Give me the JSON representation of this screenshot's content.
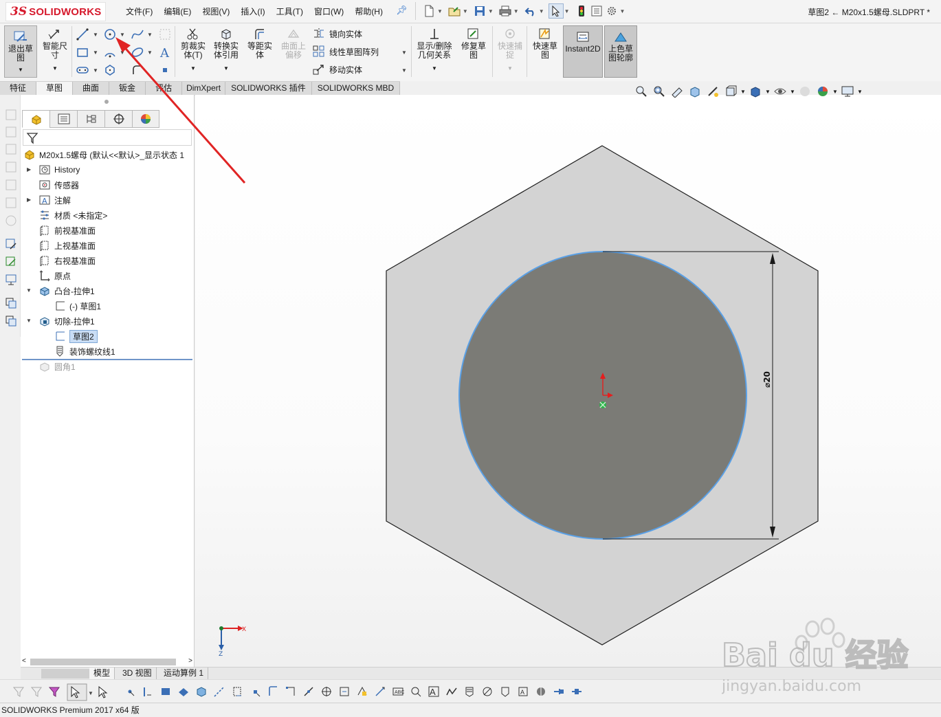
{
  "app": {
    "brand_ds": "3S",
    "brand_name": "SOLIDWORKS",
    "document_title": "草图2 ← M20x1.5螺母.SLDPRT *",
    "status_text": "SOLIDWORKS Premium 2017 x64 版"
  },
  "menu": [
    "文件(F)",
    "编辑(E)",
    "视图(V)",
    "插入(I)",
    "工具(T)",
    "窗口(W)",
    "帮助(H)"
  ],
  "ribbon": {
    "exit_sketch": [
      "退出草",
      "图"
    ],
    "smart_dim": [
      "智能尺",
      "寸"
    ],
    "trim": [
      "剪裁实",
      "体(T)"
    ],
    "convert": [
      "转换实",
      "体引用"
    ],
    "offset": [
      "等距实",
      "体"
    ],
    "surface_offset": [
      "曲面上",
      "偏移"
    ],
    "mirror": "镜向实体",
    "linear_pattern": "线性草图阵列",
    "move": "移动实体",
    "show_relations": [
      "显示/删除",
      "几何关系"
    ],
    "repair": [
      "修复草",
      "图"
    ],
    "rapid_snap": [
      "快速捕",
      "捉"
    ],
    "rapid_sketch": [
      "快速草",
      "图"
    ],
    "instant2d": "Instant2D",
    "shaded_sketch": [
      "上色草",
      "图轮廓"
    ]
  },
  "tabs": [
    "特征",
    "草图",
    "曲面",
    "钣金",
    "评估",
    "DimXpert",
    "SOLIDWORKS 插件",
    "SOLIDWORKS MBD"
  ],
  "active_tab": "草图",
  "tree": {
    "root": "M20x1.5螺母  (默认<<默认>_显示状态 1",
    "items": [
      {
        "label": "History"
      },
      {
        "label": "传感器"
      },
      {
        "label": "注解"
      },
      {
        "label": "材质 <未指定>"
      },
      {
        "label": "前视基准面"
      },
      {
        "label": "上视基准面"
      },
      {
        "label": "右视基准面"
      },
      {
        "label": "原点"
      },
      {
        "label": "凸台-拉伸1"
      },
      {
        "label": "(-) 草图1"
      },
      {
        "label": "切除-拉伸1"
      },
      {
        "label": "草图2"
      },
      {
        "label": "装饰螺纹线1"
      },
      {
        "label": "圆角1"
      }
    ]
  },
  "bottom_tabs": [
    "模型",
    "3D 视图",
    "运动算例 1"
  ],
  "drawing": {
    "dimension_label": "⌀20",
    "triad_x": "X",
    "triad_z": "Z"
  },
  "watermark": {
    "line1": "Bai du 经验",
    "line2": "jingyan.baidu.com"
  },
  "colors": {
    "hex_fill": "#d3d3d3",
    "circle_fill": "#7b7b76",
    "circle_edge": "#5aa0e6",
    "origin_red": "#e51e1e",
    "arrow_red": "#e02424",
    "selection_blue": "#c9ddf5"
  }
}
